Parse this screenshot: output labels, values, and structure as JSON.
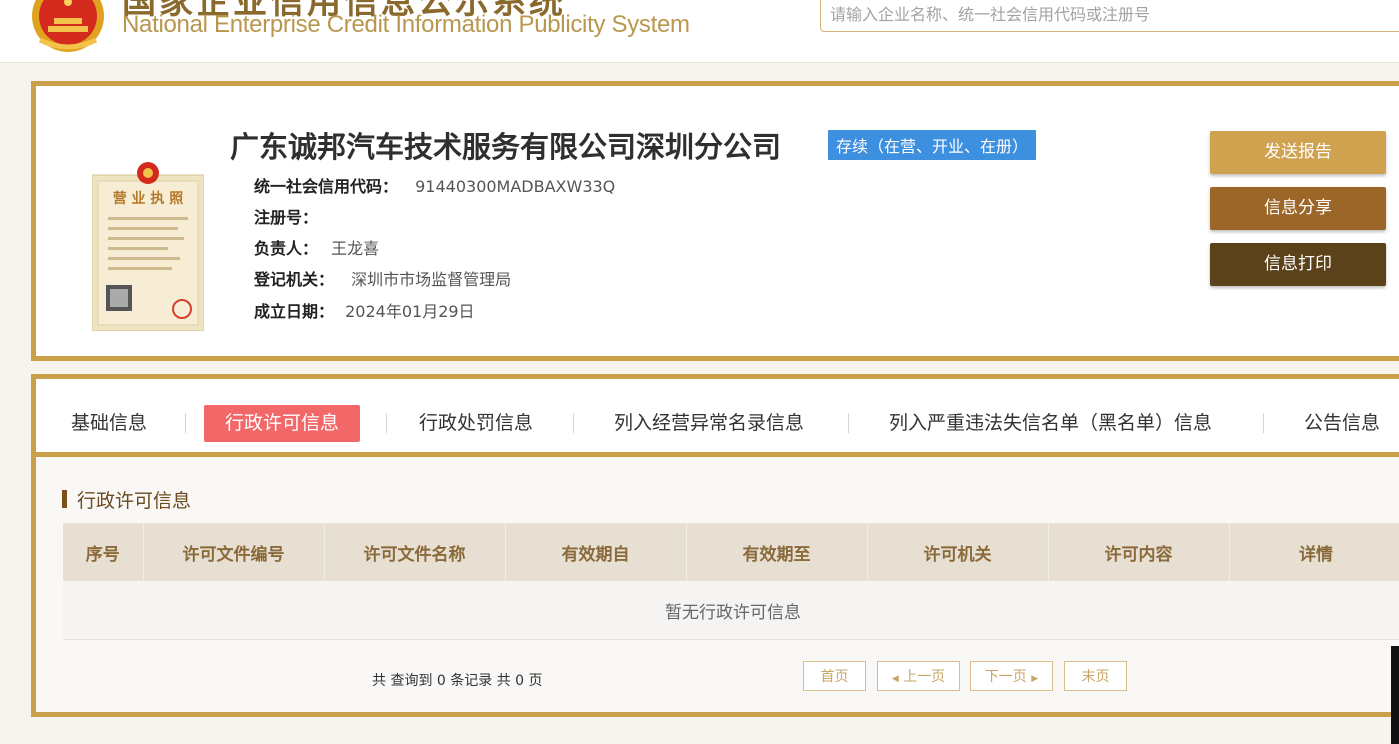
{
  "header": {
    "system_title_cn": "国家企业信用信息公示系统",
    "system_title_en": "National Enterprise Credit Information Publicity System",
    "search_placeholder": "请输入企业名称、统一社会信用代码或注册号"
  },
  "company": {
    "name": "广东诚邦汽车技术服务有限公司深圳分公司",
    "status": "存续（在营、开业、在册）",
    "fields": [
      {
        "label": "统一社会信用代码：",
        "value": "91440300MADBAXW33Q"
      },
      {
        "label": "注册号：",
        "value": ""
      },
      {
        "label": "负责人：",
        "value": "王龙喜"
      },
      {
        "label": "登记机关：",
        "value": "深圳市市场监督管理局"
      },
      {
        "label": "成立日期：",
        "value": "2024年01月29日"
      }
    ],
    "license_image_text": "营业执照"
  },
  "actions": [
    {
      "label": "发送报告",
      "color": "#cfa24f"
    },
    {
      "label": "信息分享",
      "color": "#9b6627"
    },
    {
      "label": "信息打印",
      "color": "#5b421a"
    }
  ],
  "tabs": [
    {
      "label": "基础信息",
      "active": false
    },
    {
      "label": "行政许可信息",
      "active": true
    },
    {
      "label": "行政处罚信息",
      "active": false
    },
    {
      "label": "列入经营异常名录信息",
      "active": false
    },
    {
      "label": "列入严重违法失信名单（黑名单）信息",
      "active": false
    },
    {
      "label": "公告信息",
      "active": false
    }
  ],
  "section": {
    "title": "行政许可信息",
    "columns": [
      "序号",
      "许可文件编号",
      "许可文件名称",
      "有效期自",
      "有效期至",
      "许可机关",
      "许可内容",
      "详情"
    ],
    "empty_text": "暂无行政许可信息"
  },
  "pagination": {
    "summary": "共 查询到 0 条记录 共 0 页",
    "first": "首页",
    "prev": "上一页",
    "next": "下一页",
    "last": "末页"
  },
  "colors": {
    "gold_border": "#caa04a",
    "status_blue": "#3d8fe0",
    "active_tab": "#f26868",
    "table_header": "#e7dfd2"
  }
}
